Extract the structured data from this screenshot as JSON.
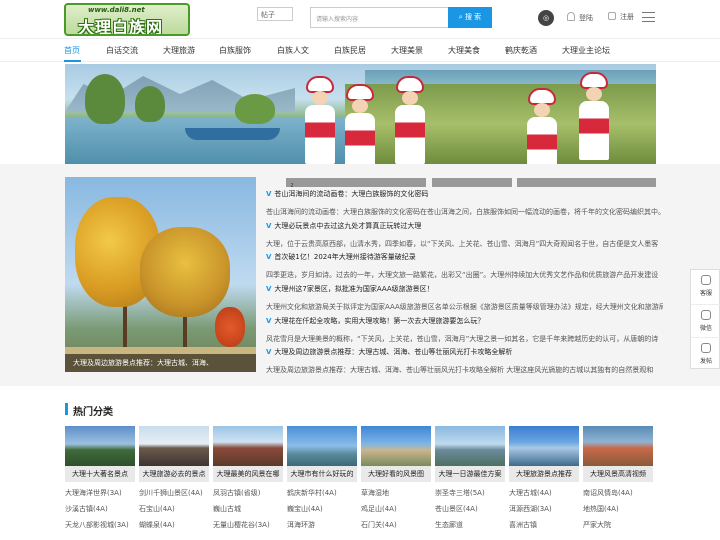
{
  "header": {
    "logo_url": "www.dali8.net",
    "logo_name": "大理白族网",
    "search_type": "帖子",
    "search_placeholder": "请输入搜索内容",
    "search_button": "搜 索",
    "login": "登陆",
    "register": "注册"
  },
  "nav": {
    "items": [
      "首页",
      "白话交流",
      "大理旅游",
      "白族服饰",
      "白族人文",
      "白族民居",
      "大理美景",
      "大理美食",
      "鹤庆乾酒",
      "大理业主论坛"
    ]
  },
  "banner": {
    "dots": 4,
    "active_dot": 3
  },
  "content": {
    "tabs": [
      "",
      "2",
      ""
    ],
    "featured_caption": "大理及周边旅游景点推荐：大理古城、洱海、",
    "articles": [
      {
        "title": "苍山洱海间的流动画卷：大理白族服饰的文化密码",
        "desc": "苍山洱海间的流动画卷：大理白族服饰的文化密码在苍山洱海之间，白族服饰如同一幅流动的画卷，将千年的文化密码编织其中。"
      },
      {
        "title": "大理必玩景点中去过这九处才算真正玩转过大理",
        "desc": "大理，位于云贵高原西部，山清水秀，四季如春，以“下关风、上关花、苍山雪、洱海月”四大奇观闻名于世，自古便是文人墨客"
      },
      {
        "title": "首次破1亿！2024年大理州接待游客量破纪录",
        "desc": "四季更迭，岁月如诗。过去的一年，大理文旅一路繁花，出彩又“出圈”。大理州持续加大优秀文艺作品和优质旅游产品开发建设"
      },
      {
        "title": "大理州这7家景区，拟批准为国家AAA级旅游景区！",
        "desc": "大理州文化和旅游局关于拟评定为国家AAA级旅游景区名单公示根据《旅游景区质量等级管理办法》规定，经大理州文化和旅游局"
      },
      {
        "title": "大理花在仟起全攻略，实用大理攻略！第一次去大理旅游要怎么玩？",
        "desc": "风花雪月是大理美景的概称，“下关风，上关花，苍山雪，洱海月”大理之景一如其名，它是千年来跨越历史的认可，从唐朝的诗"
      },
      {
        "title": "大理及周边旅游景点推荐：大理古城、洱海、苍山等壮丽风光打卡攻略全解析",
        "desc": "大理及周边旅游景点推荐：大理古城、洱海、苍山等壮丽风光打卡攻略全解析 大理这座风光旖旎的古城以其独有的自然景观和"
      }
    ]
  },
  "side": {
    "items": [
      "客服",
      "微信",
      "发帖"
    ]
  },
  "hot": {
    "title": "热门分类",
    "cards": [
      "大理十大著名景点",
      "大理旅游必去的景点",
      "大理最美的风景在哪",
      "大理市有什么好玩的",
      "大理好看的风景图",
      "大理一日游最佳方案",
      "大理旅游景点推荐",
      "大理风景高清视频"
    ],
    "links": [
      [
        "大理海洋世界(3A)",
        "剑川千狮山景区(4A)",
        "凤羽古镇(省级)",
        "鹤庆新华村(4A)",
        "草海湿地",
        "崇圣寺三塔(5A)",
        "大理古城(4A)",
        "南诏风情岛(4A)"
      ],
      [
        "沙溪古镇(4A)",
        "石宝山(4A)",
        "巍山古城",
        "巍宝山(4A)",
        "鸡足山(4A)",
        "苍山景区(4A)",
        "洱源西湖(3A)",
        "地热国(4A)"
      ],
      [
        "天龙八部影视城(3A)",
        "蝴蝶泉(4A)",
        "无量山樱花谷(3A)",
        "洱海环游",
        "石门关(4A)",
        "生态廊道",
        "喜洲古镇",
        "严家大院"
      ]
    ]
  },
  "colors": {
    "accent": "#1a96e4",
    "logo_green": "#4a9a28"
  }
}
